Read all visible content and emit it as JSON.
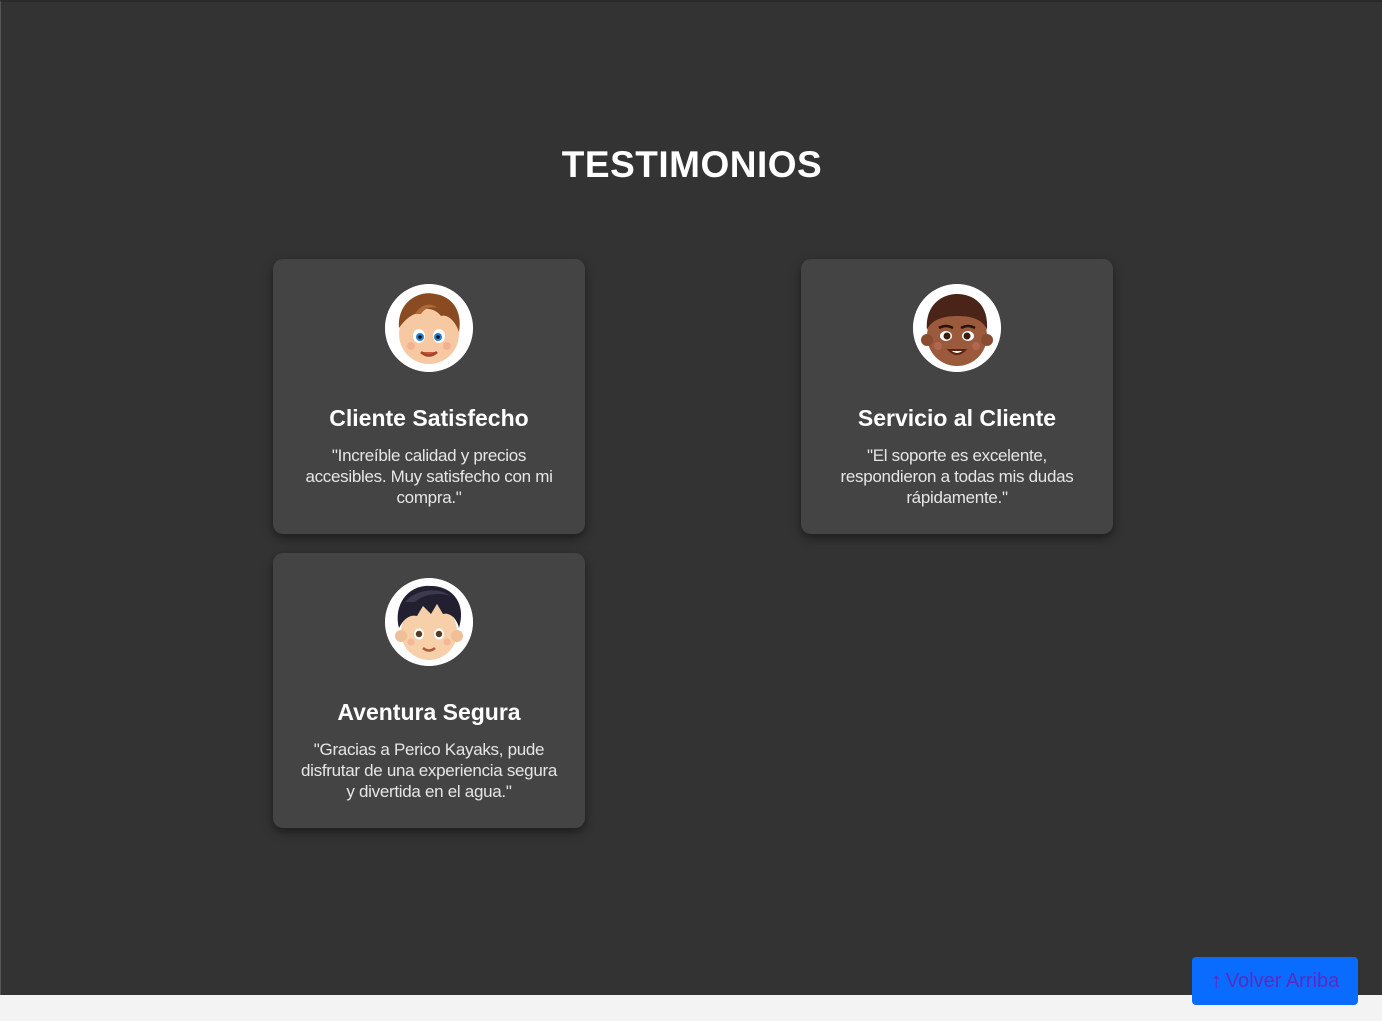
{
  "section": {
    "title": "TESTIMONIOS"
  },
  "testimonials": [
    {
      "name": "Cliente Satisfecho",
      "quote": "\"Increíble calidad y precios accesibles. Muy satisfecho con mi compra.\"",
      "avatar_icon": "boy-brown-hair-avatar-icon"
    },
    {
      "name": "Servicio al Cliente",
      "quote": "\"El soporte es excelente, respondieron a todas mis dudas rápidamente.\"",
      "avatar_icon": "boy-dark-skin-avatar-icon"
    },
    {
      "name": "Aventura Segura",
      "quote": "\"Gracias a Perico Kayaks, pude disfrutar de una experiencia segura y divertida en el agua.\"",
      "avatar_icon": "boy-black-hair-avatar-icon"
    }
  ],
  "back_to_top": {
    "arrow": "↑",
    "label": "Volver Arriba"
  },
  "colors": {
    "background": "#333333",
    "card": "#444444",
    "button": "#0a6cff",
    "button_text": "#5a2bc2",
    "footer_strip": "#f3f3f3"
  }
}
